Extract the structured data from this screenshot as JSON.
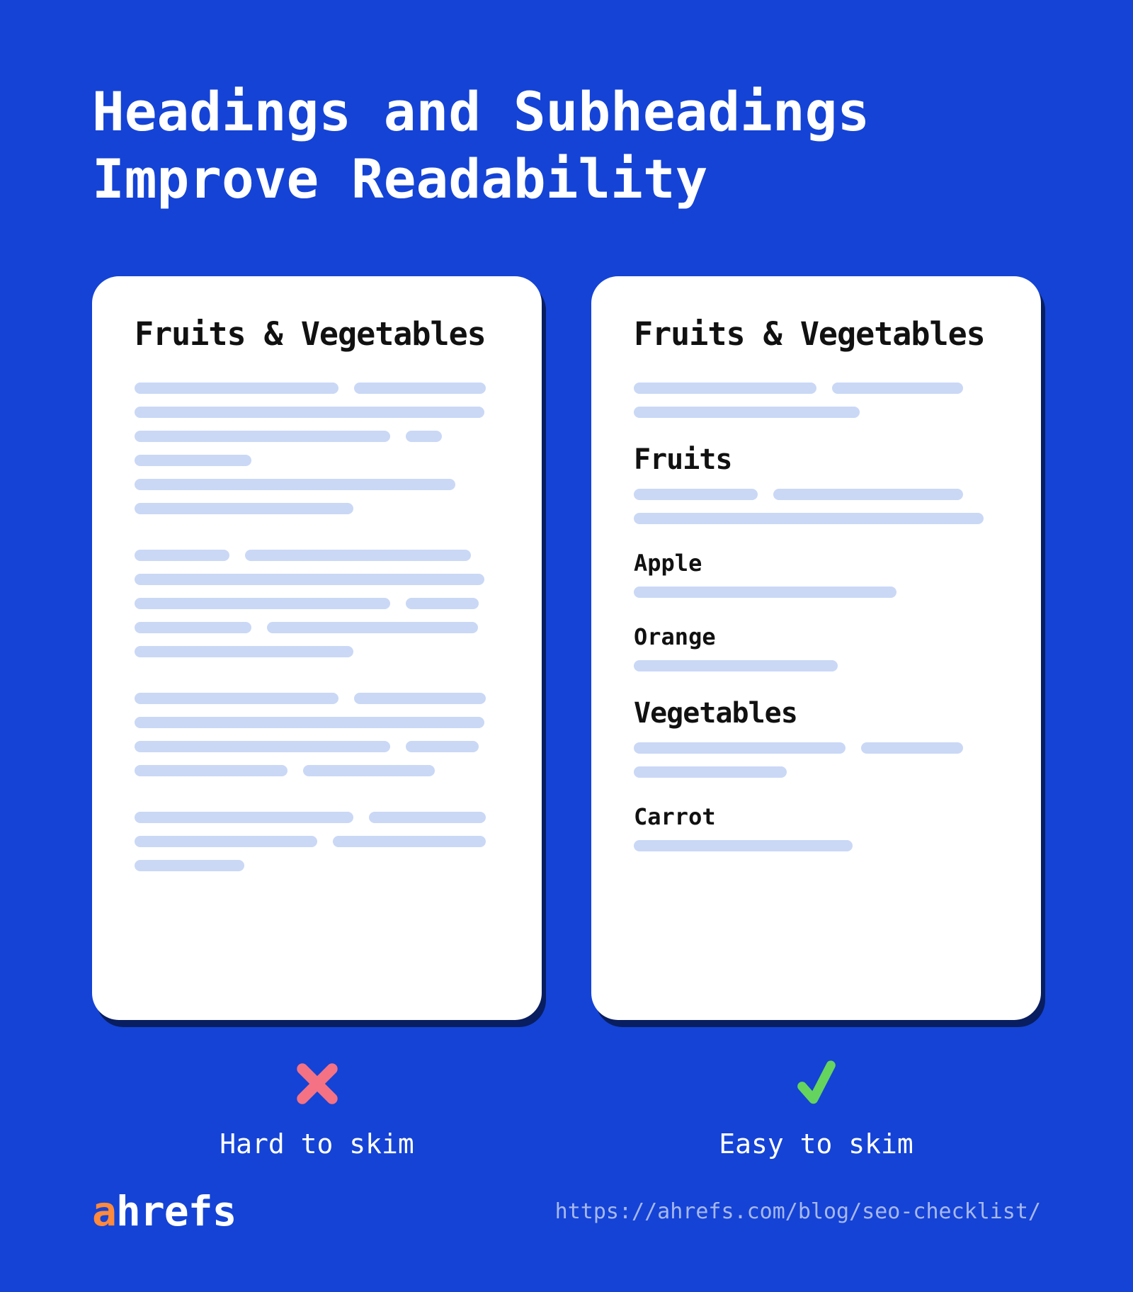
{
  "title_line1": "Headings and Subheadings",
  "title_line2": "Improve Readability",
  "left": {
    "heading": "Fruits & Vegetables",
    "caption": "Hard to skim"
  },
  "right": {
    "heading": "Fruits & Vegetables",
    "sub1": "Fruits",
    "item1": "Apple",
    "item2": "Orange",
    "sub2": "Vegetables",
    "item3": "Carrot",
    "caption": "Easy to skim"
  },
  "brand": {
    "first": "a",
    "rest": "hrefs"
  },
  "url": "https://ahrefs.com/blog/seo-checklist/",
  "colors": {
    "background": "#1443d6",
    "bar": "#cad8f6",
    "cross": "#f47284",
    "check": "#65d45e",
    "brand_accent": "#ff8a3c"
  }
}
